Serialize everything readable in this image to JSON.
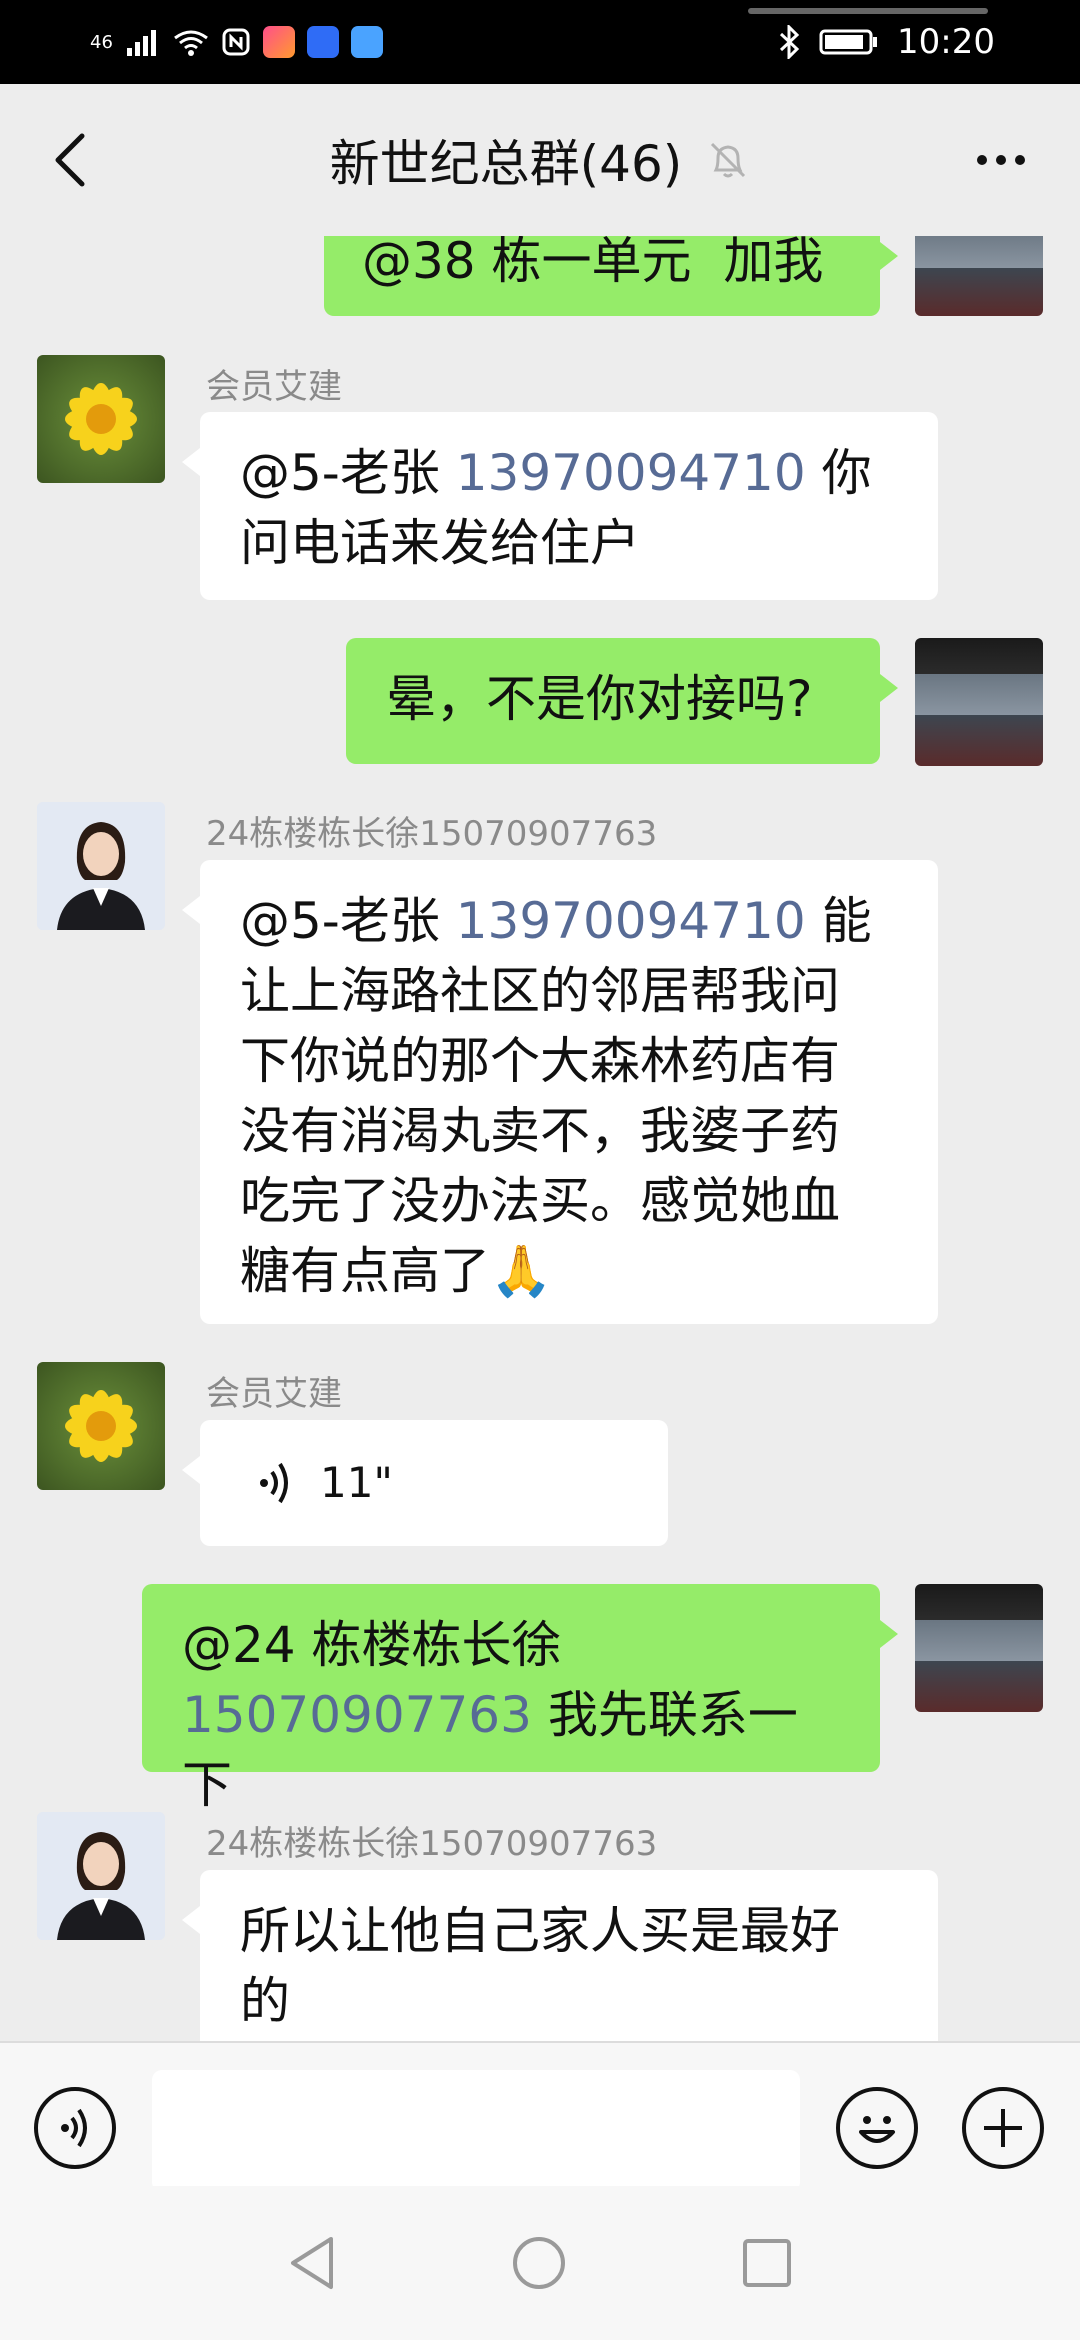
{
  "status_bar": {
    "network": "46",
    "time": "10:20"
  },
  "header": {
    "title": "新世纪总群(46)",
    "back_icon": "back-chevron-icon",
    "mute_icon": "bell-muted-icon",
    "more_icon": "more-dots-icon"
  },
  "messages": [
    {
      "side": "right",
      "text_mention": "@38 栋一单元",
      "text": "加我"
    },
    {
      "side": "left",
      "sender": "会员艾建",
      "avatar": "flower-avatar",
      "line1_prefix": "@5-老张 ",
      "line1_phone": "13970094710",
      "line1_suffix": " 你",
      "line2": "问电话来发给住户"
    },
    {
      "side": "right",
      "text": "晕，不是你对接吗?"
    },
    {
      "side": "left",
      "sender": "24栋楼栋长徐15070907763",
      "avatar": "woman-avatar",
      "line1_prefix": "@5-老张 ",
      "line1_phone": "13970094710",
      "line1_suffix": " 能",
      "lines": [
        "让上海路社区的邻居帮我问",
        "下你说的那个大森林药店有",
        "没有消渴丸卖不，我婆子药",
        "吃完了没办法买。感觉她血",
        "糖有点高了"
      ],
      "emoji": "🙏"
    },
    {
      "side": "left",
      "sender": "会员艾建",
      "avatar": "flower-avatar",
      "voice_duration": "11\""
    },
    {
      "side": "right",
      "line1": "@24 栋楼栋长徐",
      "line2_phone": "15070907763",
      "line2_suffix": " 我先联系一下"
    },
    {
      "side": "left",
      "sender": "24栋楼栋长徐15070907763",
      "avatar": "woman-avatar",
      "lines": [
        "所以让他自己家人买是最好",
        "的"
      ]
    }
  ],
  "colors": {
    "green_bubble": "#95ec69",
    "white_bubble": "#ffffff",
    "link": "#576b95",
    "background": "#ededed"
  }
}
